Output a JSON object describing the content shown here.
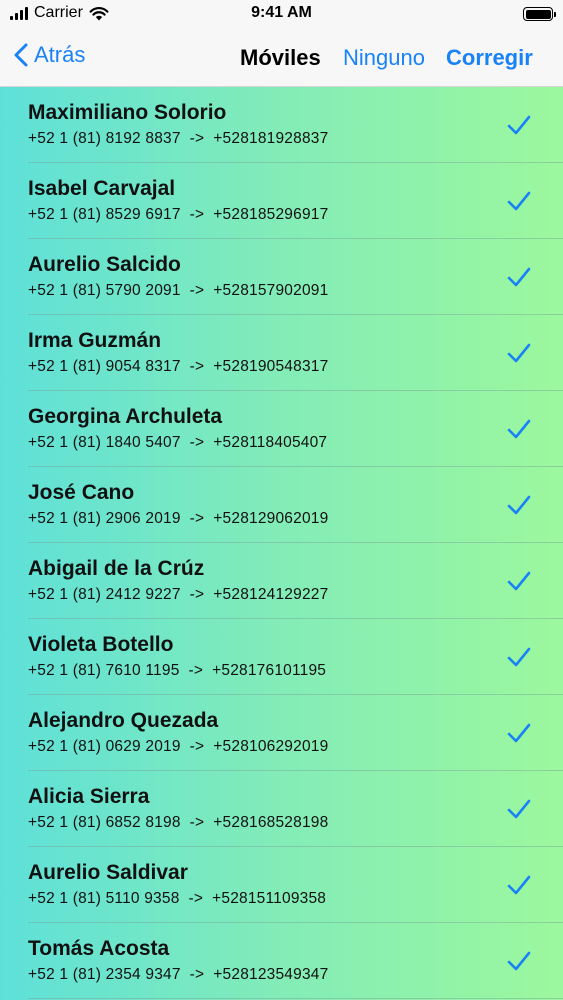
{
  "status_bar": {
    "carrier": "Carrier",
    "time": "9:41 AM",
    "icons": [
      "signal-icon",
      "wifi-icon",
      "battery-icon"
    ]
  },
  "nav": {
    "back_label": "Atrás",
    "title": "Móviles",
    "none_label": "Ninguno",
    "edit_label": "Corregir"
  },
  "colors": {
    "accent": "#1a82f7",
    "gradient_start": "#5ee0d9",
    "gradient_end": "#9cf89e"
  },
  "contacts": [
    {
      "name": "Maximiliano Solorio",
      "phone": "+52 1 (81) 8192 8837  ->  +528181928837",
      "checked": true
    },
    {
      "name": "Isabel Carvajal",
      "phone": "+52 1 (81) 8529 6917  ->  +528185296917",
      "checked": true
    },
    {
      "name": "Aurelio Salcido",
      "phone": "+52 1 (81) 5790 2091  ->  +528157902091",
      "checked": true
    },
    {
      "name": "Irma Guzmán",
      "phone": "+52 1 (81) 9054 8317  ->  +528190548317",
      "checked": true
    },
    {
      "name": "Georgina Archuleta",
      "phone": "+52 1 (81) 1840 5407  ->  +528118405407",
      "checked": true
    },
    {
      "name": "José Cano",
      "phone": "+52 1 (81) 2906 2019  ->  +528129062019",
      "checked": true
    },
    {
      "name": "Abigail de la Crúz",
      "phone": "+52 1 (81) 2412 9227  ->  +528124129227",
      "checked": true
    },
    {
      "name": "Violeta Botello",
      "phone": "+52 1 (81) 7610 1195  ->  +528176101195",
      "checked": true
    },
    {
      "name": "Alejandro Quezada",
      "phone": "+52 1 (81) 0629 2019  ->  +528106292019",
      "checked": true
    },
    {
      "name": "Alicia Sierra",
      "phone": "+52 1 (81) 6852 8198  ->  +528168528198",
      "checked": true
    },
    {
      "name": "Aurelio Saldivar",
      "phone": "+52 1 (81) 5110 9358  ->  +528151109358",
      "checked": true
    },
    {
      "name": "Tomás Acosta",
      "phone": "+52 1 (81) 2354 9347  ->  +528123549347",
      "checked": true
    }
  ]
}
